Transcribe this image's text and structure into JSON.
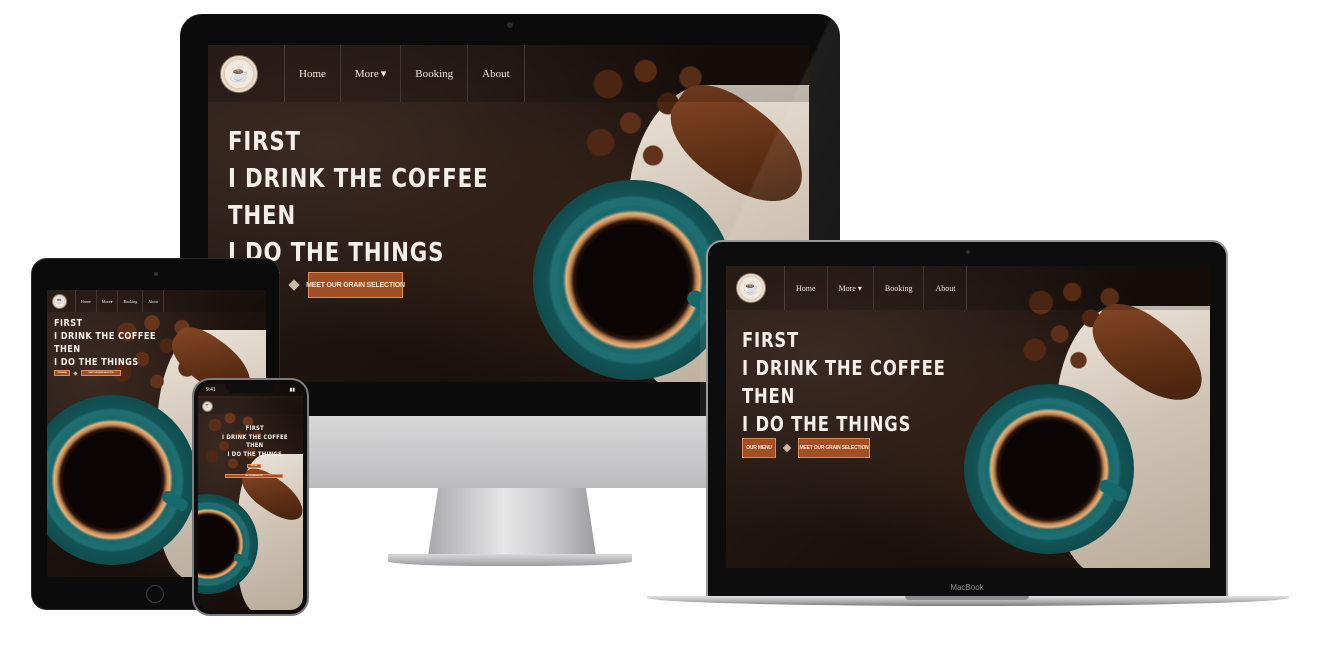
{
  "site": {
    "logo_alt": "coffee-house-logo",
    "nav": [
      "Home",
      "More",
      "Booking",
      "About"
    ],
    "more_caret": "▾",
    "headline": [
      "FIRST",
      "I DRINK THE COFFEE",
      "THEN",
      "I DO THE THINGS"
    ],
    "buttons": {
      "menu": "OUR MENU",
      "grain": "MEET OUR GRAIN SELECTION"
    }
  },
  "devices": {
    "macbook_label": "MacBook",
    "iphone_time": "9:41",
    "apple_logo": ""
  },
  "colors": {
    "button_bg": "#a14f24",
    "button_border": "#e08a56",
    "headline": "#f4efe9",
    "cup_teal": "#137072",
    "background_dark": "#1a110d"
  },
  "icons": [
    "apple-logo-icon",
    "chevron-down-icon",
    "diamond-separator-icon",
    "coffee-logo-icon"
  ]
}
